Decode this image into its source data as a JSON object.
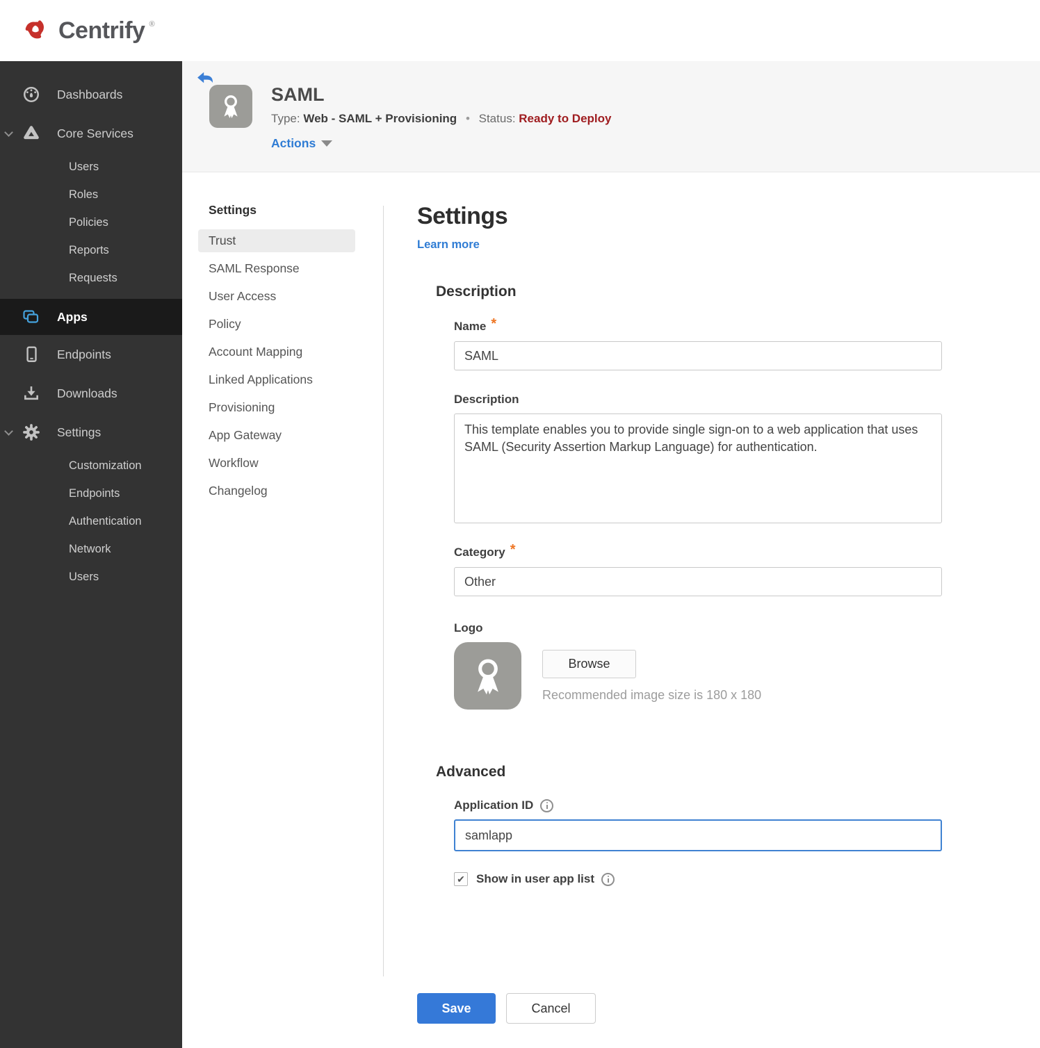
{
  "brand": {
    "name": "Centrify",
    "mark": "®"
  },
  "sidebar": {
    "items": [
      {
        "label": "Dashboards"
      },
      {
        "label": "Core Services",
        "expanded": true,
        "children": [
          {
            "label": "Users"
          },
          {
            "label": "Roles"
          },
          {
            "label": "Policies"
          },
          {
            "label": "Reports"
          },
          {
            "label": "Requests"
          }
        ]
      },
      {
        "label": "Apps",
        "selected": true
      },
      {
        "label": "Endpoints"
      },
      {
        "label": "Downloads"
      },
      {
        "label": "Settings",
        "expanded": true,
        "children": [
          {
            "label": "Customization"
          },
          {
            "label": "Endpoints"
          },
          {
            "label": "Authentication"
          },
          {
            "label": "Network"
          },
          {
            "label": "Users"
          }
        ]
      }
    ]
  },
  "app_header": {
    "title": "SAML",
    "type_label": "Type:",
    "type_value": "Web - SAML + Provisioning",
    "separator": "•",
    "status_label": "Status:",
    "status_value": "Ready to Deploy",
    "actions_label": "Actions"
  },
  "subnav": {
    "header": "Settings",
    "items": [
      {
        "label": "Trust",
        "selected": true
      },
      {
        "label": "SAML Response"
      },
      {
        "label": "User Access"
      },
      {
        "label": "Policy"
      },
      {
        "label": "Account Mapping"
      },
      {
        "label": "Linked Applications"
      },
      {
        "label": "Provisioning"
      },
      {
        "label": "App Gateway"
      },
      {
        "label": "Workflow"
      },
      {
        "label": "Changelog"
      }
    ]
  },
  "form": {
    "title": "Settings",
    "learn_more": "Learn more",
    "description_section": {
      "heading": "Description",
      "name": {
        "label": "Name",
        "required": "*",
        "value": "SAML"
      },
      "description": {
        "label": "Description",
        "value": "This template enables you to provide single sign-on to a web application that uses SAML (Security Assertion Markup Language) for authentication."
      },
      "category": {
        "label": "Category",
        "required": "*",
        "value": "Other"
      },
      "logo": {
        "label": "Logo",
        "browse_label": "Browse",
        "hint": "Recommended image size is 180 x 180"
      }
    },
    "advanced_section": {
      "heading": "Advanced",
      "application_id": {
        "label": "Application ID",
        "value": "samlapp"
      },
      "show_in_user_app_list": {
        "label": "Show in user app list",
        "checked": true,
        "check_glyph": "✔"
      }
    },
    "actions": {
      "save": "Save",
      "cancel": "Cancel"
    }
  },
  "colors": {
    "accent_blue": "#3579d8",
    "link_blue": "#2f7cd4",
    "status_red": "#9f1d20",
    "required_orange": "#ee7624",
    "sidebar_bg": "#333333",
    "sidebar_selected_bg": "#1a1a1a",
    "app_icon_blue": "#45a2dd",
    "logo_red": "#c6312b",
    "app_tile_gray": "#9c9c98"
  }
}
